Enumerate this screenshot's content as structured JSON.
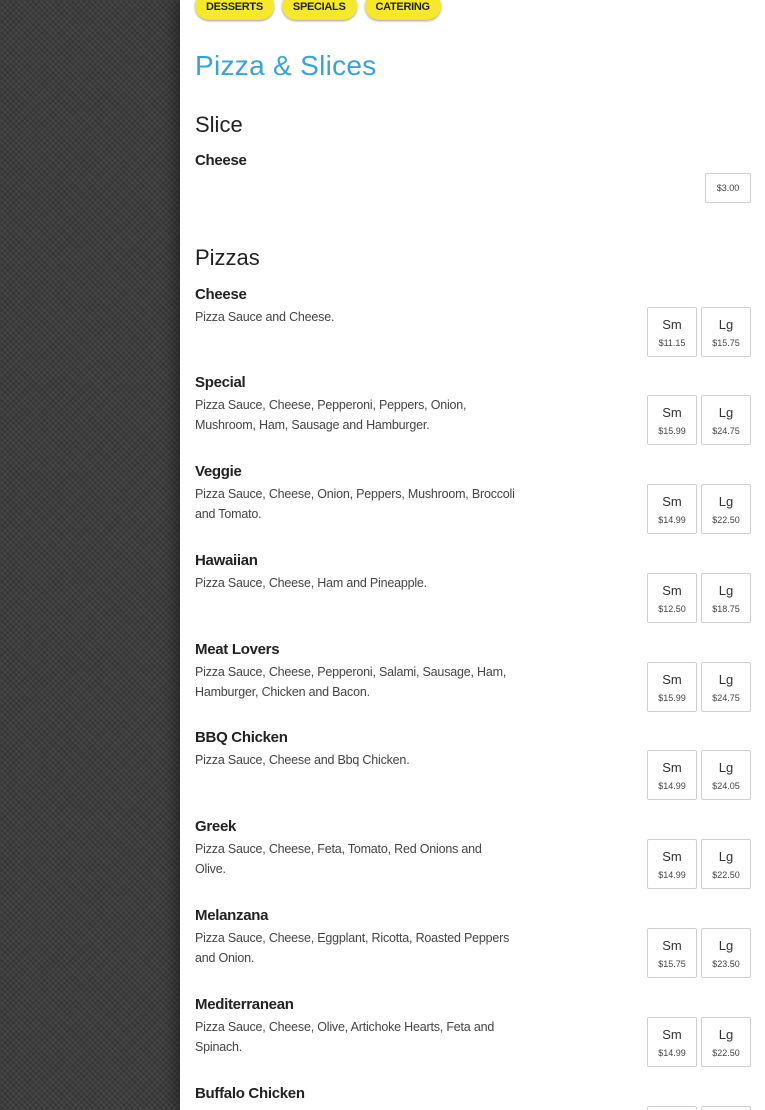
{
  "nav": [
    "DESSERTS",
    "SPECIALS",
    "CATERING"
  ],
  "page_title": "Pizza & Slices",
  "slice_section": {
    "title": "Slice",
    "items": [
      {
        "name": "Cheese",
        "price": "$3.00"
      }
    ]
  },
  "pizza_section": {
    "title": "Pizzas",
    "sizes": [
      "Sm",
      "Lg"
    ],
    "items": [
      {
        "name": "Cheese",
        "description": "Pizza Sauce and Cheese.",
        "prices": [
          "$11.15",
          "$15.75"
        ]
      },
      {
        "name": "Special",
        "description": "Pizza Sauce, Cheese, Pepperoni, Peppers, Onion, Mushroom, Ham, Sausage and Hamburger.",
        "prices": [
          "$15.99",
          "$24.75"
        ]
      },
      {
        "name": "Veggie",
        "description": "Pizza Sauce, Cheese, Onion, Peppers, Mushroom, Broccoli and Tomato.",
        "prices": [
          "$14.99",
          "$22.50"
        ]
      },
      {
        "name": "Hawaiian",
        "description": "Pizza Sauce, Cheese, Ham and Pineapple.",
        "prices": [
          "$12.50",
          "$18.75"
        ]
      },
      {
        "name": "Meat Lovers",
        "description": "Pizza Sauce, Cheese, Pepperoni, Salami, Sausage, Ham, Hamburger, Chicken and Bacon.",
        "prices": [
          "$15.99",
          "$24.75"
        ]
      },
      {
        "name": "BBQ Chicken",
        "description": "Pizza Sauce, Cheese and Bbq Chicken.",
        "prices": [
          "$14.99",
          "$24.05"
        ]
      },
      {
        "name": "Greek",
        "description": "Pizza Sauce, Cheese, Feta, Tomato, Red Onions and Olive.",
        "prices": [
          "$14.99",
          "$22.50"
        ]
      },
      {
        "name": "Melanzana",
        "description": "Pizza Sauce, Cheese, Eggplant, Ricotta, Roasted Peppers and Onion.",
        "prices": [
          "$15.75",
          "$23.50"
        ]
      },
      {
        "name": "Mediterranean",
        "description": "Pizza Sauce, Cheese, Olive, Artichoke Hearts, Feta and Spinach.",
        "prices": [
          "$14.99",
          "$22.50"
        ]
      },
      {
        "name": "Buffalo Chicken"
      }
    ]
  }
}
